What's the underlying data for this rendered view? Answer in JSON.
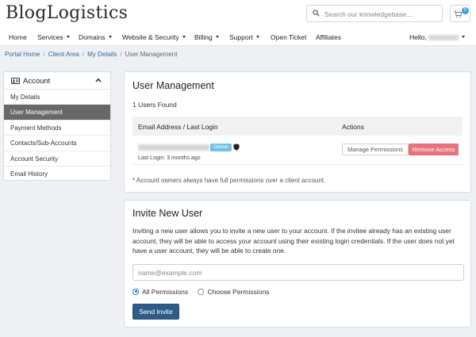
{
  "brand": {
    "logo_text": "BlogLogistics"
  },
  "search": {
    "placeholder": "Search our knowledgebase..."
  },
  "cart": {
    "count": "0"
  },
  "nav": {
    "items": [
      {
        "label": "Home"
      },
      {
        "label": "Services"
      },
      {
        "label": "Domains"
      },
      {
        "label": "Website & Security"
      },
      {
        "label": "Billing"
      },
      {
        "label": "Support"
      },
      {
        "label": "Open Ticket"
      },
      {
        "label": "Affiliates"
      }
    ],
    "greeting": "Hello,"
  },
  "breadcrumb": {
    "items": [
      "Portal Home",
      "Client Area",
      "My Details",
      "User Management"
    ],
    "separator": "/"
  },
  "sidebar": {
    "title": "Account",
    "items": [
      {
        "label": "My Details"
      },
      {
        "label": "User Management"
      },
      {
        "label": "Payment Methods"
      },
      {
        "label": "Contacts/Sub-Accounts"
      },
      {
        "label": "Account Security"
      },
      {
        "label": "Email History"
      }
    ]
  },
  "user_management": {
    "title": "User Management",
    "users_found": "1 Users Found",
    "columns": [
      "Email Address / Last Login",
      "Actions"
    ],
    "user": {
      "badge": "Owner",
      "last_login": "Last Login: 3 months ago"
    },
    "manage_label": "Manage Permissions",
    "remove_label": "Remove Access",
    "note": "* Account owners always have full permissions over a client account."
  },
  "invite": {
    "title": "Invite New User",
    "description": "Inviting a new user allows you to invite a new user to your account. If the invitee already has an existing user account, they will be able to access your account using their existing login credentials. If the user does not yet have a user account, they will be able to create one.",
    "email_placeholder": "name@example.com",
    "options": [
      "All Permissions",
      "Choose Permissions"
    ],
    "button_label": "Send Invite"
  },
  "colors": {
    "primary_button": "#2e5c8a",
    "danger_button": "#ea737b",
    "owner_badge": "#6fc1e6",
    "active_sidebar": "#686868",
    "link": "#2e6da4"
  }
}
